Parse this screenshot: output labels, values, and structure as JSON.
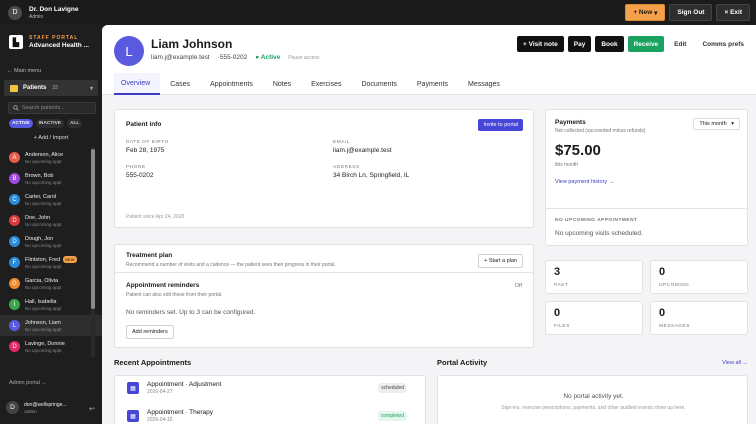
{
  "topbar": {
    "avatar_initial": "D",
    "user_name": "Dr. Don Lavigne",
    "user_role": "Admin",
    "new_label": "+ New",
    "new_chevron": "▾",
    "signout_label": "Sign Out",
    "exit_label": "Exit",
    "exit_icon": "×"
  },
  "sidebar": {
    "brand_icon": "▙",
    "brand_kicker": "STAFF PORTAL",
    "brand_name": "Advanced Health ...",
    "main_menu": "← Main menu",
    "patients_label": "Patients",
    "patients_count": "33",
    "patients_chevron": "▾",
    "search_placeholder": "Search patients...",
    "filters": [
      "ACTIVE",
      "INACTIVE",
      "ALL"
    ],
    "add_import": "+ Add / Import",
    "patients": [
      {
        "initial": "A",
        "name": "Anderson, Alice",
        "status": "No upcoming appt",
        "color": "#e85d4a"
      },
      {
        "initial": "B",
        "name": "Brown, Bob",
        "status": "No upcoming appt",
        "color": "#9b4ae0"
      },
      {
        "initial": "C",
        "name": "Carter, Carol",
        "status": "No upcoming appt",
        "color": "#2a8ad8"
      },
      {
        "initial": "D",
        "name": "Doe, John",
        "status": "No upcoming appt",
        "color": "#d83a3a"
      },
      {
        "initial": "D",
        "name": "Dough, Jon",
        "status": "No upcoming appt",
        "color": "#2a8ad8"
      },
      {
        "initial": "F",
        "name": "Flintston, Fred",
        "status": "No upcoming appt",
        "color": "#2a8ad8",
        "badge": "NEW"
      },
      {
        "initial": "G",
        "name": "Garcia, Olivia",
        "status": "No upcoming appt",
        "color": "#f08a2a"
      },
      {
        "initial": "I",
        "name": "Hall, Isabella",
        "status": "No upcoming appt",
        "color": "#3aa84a"
      },
      {
        "initial": "L",
        "name": "Johnson, Liam",
        "status": "No upcoming appt",
        "color": "#5a5ae0"
      },
      {
        "initial": "D",
        "name": "Lavinge, Donnie",
        "status": "No upcoming appt",
        "color": "#e02a6a"
      }
    ],
    "admin_portal": "Admin portal →",
    "user_initial": "D",
    "user_email": "don@wellspringe...",
    "user_role": "Admin",
    "logout_icon": "↩"
  },
  "header": {
    "avatar_initial": "L",
    "patient_name": "Liam Johnson",
    "email": "liam.j@example.test",
    "phone": "·555-0202",
    "status": "● Active",
    "pause_label": "Pause access",
    "actions": {
      "visit_note": "+ Visit note",
      "pay": "Pay",
      "book": "Book",
      "receive": "Receive",
      "edit": "Edit",
      "comms": "Comms prefs"
    }
  },
  "tabs": [
    "Overview",
    "Cases",
    "Appointments",
    "Notes",
    "Exercises",
    "Documents",
    "Payments",
    "Messages"
  ],
  "patient_info": {
    "title": "Patient info",
    "invite_label": "Invite to portal",
    "dob_label": "DATE OF BIRTH",
    "dob": "Feb 28, 1975",
    "email_label": "EMAIL",
    "email": "liam.j@example.test",
    "phone_label": "PHONE",
    "phone": "555-0202",
    "address_label": "ADDRESS",
    "address": "34 Birch Ln, Springfield, IL",
    "since": "Patient since Apr 24, 2026"
  },
  "treatment_plan": {
    "title": "Treatment plan",
    "desc": "Recommend a number of visits and a cadence — the patient sees their progress in their portal.",
    "start_label": "+ Start a plan"
  },
  "reminders": {
    "title": "Appointment reminders",
    "desc": "Patient can also edit these from their portal.",
    "toggle": "Off",
    "none": "No reminders set. Up to 3 can be configured.",
    "add_label": "Add reminders"
  },
  "payments": {
    "title": "Payments",
    "subtitle": "Net collected (succeeded minus refunds)",
    "period": "This month",
    "period_chevron": "▾",
    "amount": "$75.00",
    "amount_sub": "this month",
    "history_link": "View payment history →"
  },
  "upcoming": {
    "label": "NO UPCOMING APPOINTMENT",
    "text": "No upcoming visits scheduled."
  },
  "stats": [
    {
      "num": "3",
      "label": "PAST"
    },
    {
      "num": "0",
      "label": "UPCOMING"
    },
    {
      "num": "0",
      "label": "FILES"
    },
    {
      "num": "0",
      "label": "MESSAGES"
    }
  ],
  "recent_appts": {
    "title": "Recent Appointments",
    "items": [
      {
        "name": "Appointment · Adjustment",
        "date": "2026-04-27",
        "status": "scheduled"
      },
      {
        "name": "Appointment · Therapy",
        "date": "2026-04-16",
        "status": "completed"
      }
    ]
  },
  "portal_activity": {
    "title": "Portal Activity",
    "view_all": "View all →",
    "empty": "No portal activity yet.",
    "desc": "Sign-ins, exercise prescriptions, payments, and other audited events show up here."
  },
  "colors": {
    "accent": "#4646d8",
    "green": "#1aa260",
    "orange": "#f5a04a"
  }
}
